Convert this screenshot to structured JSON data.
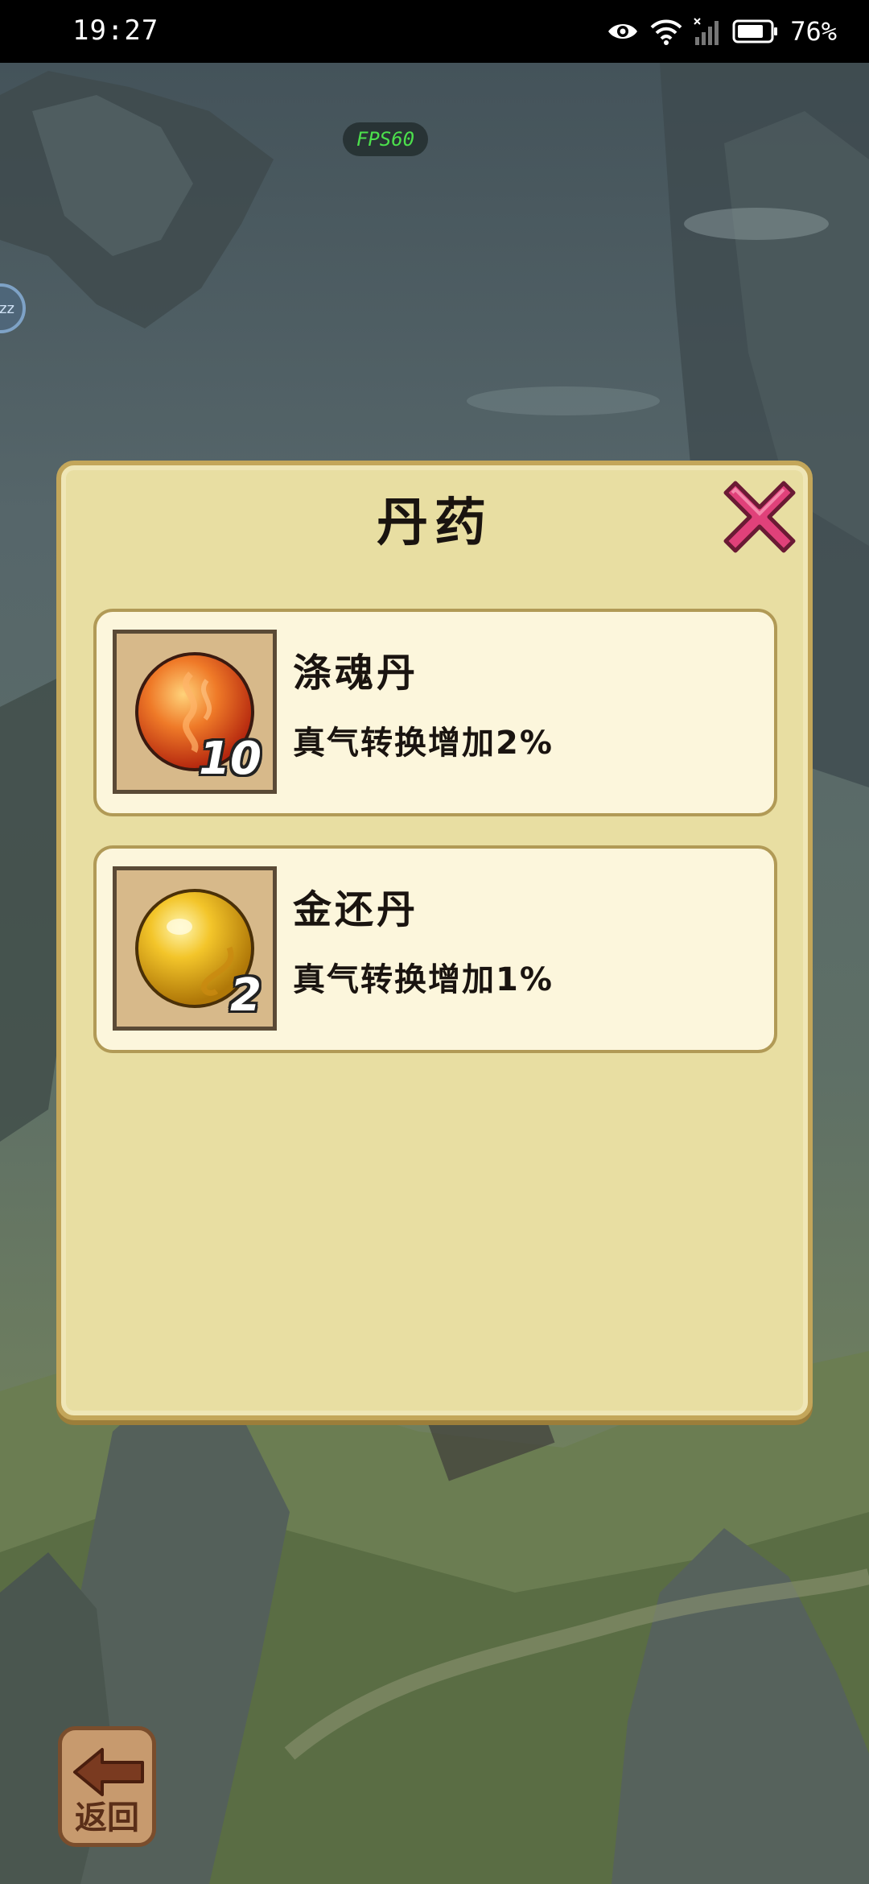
{
  "status_bar": {
    "time": "19:27",
    "battery_percent": "76%",
    "icons": [
      "eye-icon",
      "wifi-icon",
      "signal-icon",
      "battery-icon"
    ]
  },
  "fps_label": "FPS60",
  "dialog": {
    "title": "丹药",
    "close_icon": "close-x-icon",
    "items": [
      {
        "name": "涤魂丹",
        "description": "真气转换增加2%",
        "count": "10",
        "icon": "red-orb-icon"
      },
      {
        "name": "金还丹",
        "description": "真气转换增加1%",
        "count": "2",
        "icon": "gold-orb-icon"
      }
    ]
  },
  "back_button": {
    "label": "返回",
    "icon": "arrow-left-icon"
  },
  "colors": {
    "dialog_bg": "#e8dea2",
    "card_bg": "#fcf6dc",
    "close_pink": "#e0417a",
    "fps_green": "#4ce04c"
  }
}
